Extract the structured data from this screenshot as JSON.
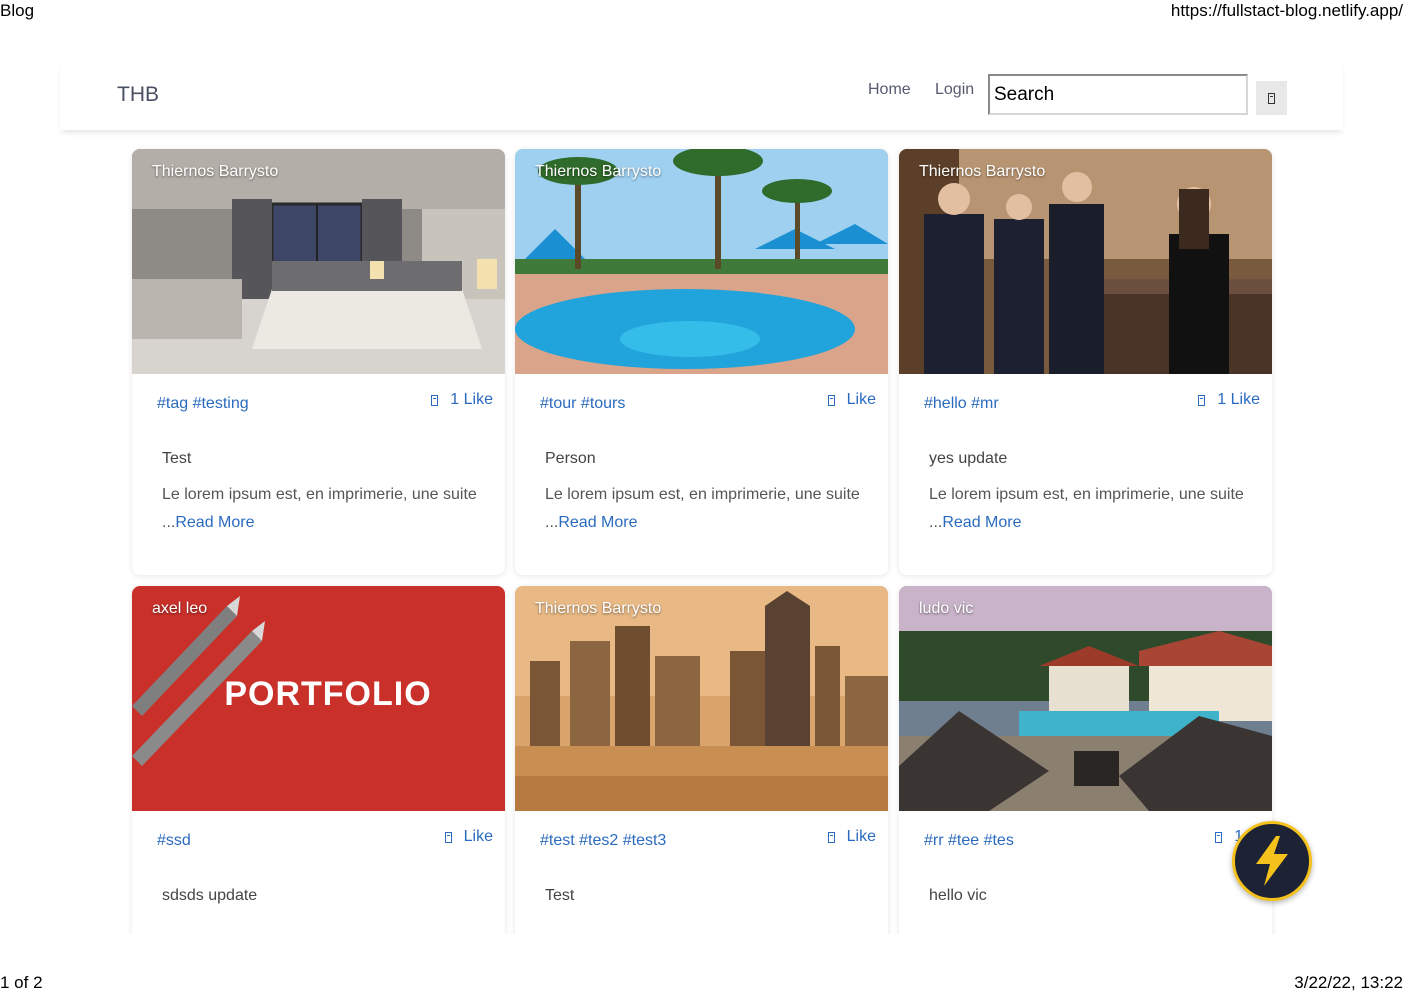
{
  "print": {
    "title": "Blog",
    "url": "https://fullstact-blog.netlify.app/",
    "page": "1 of 2",
    "datetime": "3/22/22, 13:22"
  },
  "navbar": {
    "brand": "THB",
    "home": "Home",
    "login": "Login",
    "search_value": "Search"
  },
  "posts": [
    {
      "author": "Thiernos Barrysto",
      "tags": "#tag #testing",
      "likes": "1 Like",
      "title": "Test",
      "excerpt": "Le lorem ipsum est, en imprimerie, une suite ...",
      "read_more": "Read More",
      "image": "bedroom"
    },
    {
      "author": "Thiernos Barrysto",
      "tags": "#tour #tours",
      "likes": "Like",
      "title": "Person",
      "excerpt": "Le lorem ipsum est, en imprimerie, une suite ...",
      "read_more": "Read More",
      "image": "pool"
    },
    {
      "author": "Thiernos Barrysto",
      "tags": "#hello #mr",
      "likes": "1 Like",
      "title": "yes update",
      "excerpt": "Le lorem ipsum est, en imprimerie, une suite ...",
      "read_more": "Read More",
      "image": "reception"
    },
    {
      "author": "axel leo",
      "tags": "#ssd",
      "likes": "Like",
      "title": "sdsds update",
      "excerpt": "",
      "read_more": "",
      "image": "portfolio",
      "image_text": "PORTFOLIO"
    },
    {
      "author": "Thiernos Barrysto",
      "tags": "#test #tes2 #test3",
      "likes": "Like",
      "title": "Test",
      "excerpt": "",
      "read_more": "",
      "image": "city"
    },
    {
      "author": "ludo vic",
      "tags": "#rr #tee #tes",
      "likes": "1 Li",
      "title": "hello vic",
      "excerpt": "",
      "read_more": "",
      "image": "villa"
    }
  ],
  "colors": {
    "link": "#2b6bbf",
    "badge_bg": "#1e2235",
    "badge_ring": "#f4c21a"
  },
  "icons": {
    "like": "like-icon",
    "search": "search-icon",
    "badge": "lightning-icon"
  }
}
